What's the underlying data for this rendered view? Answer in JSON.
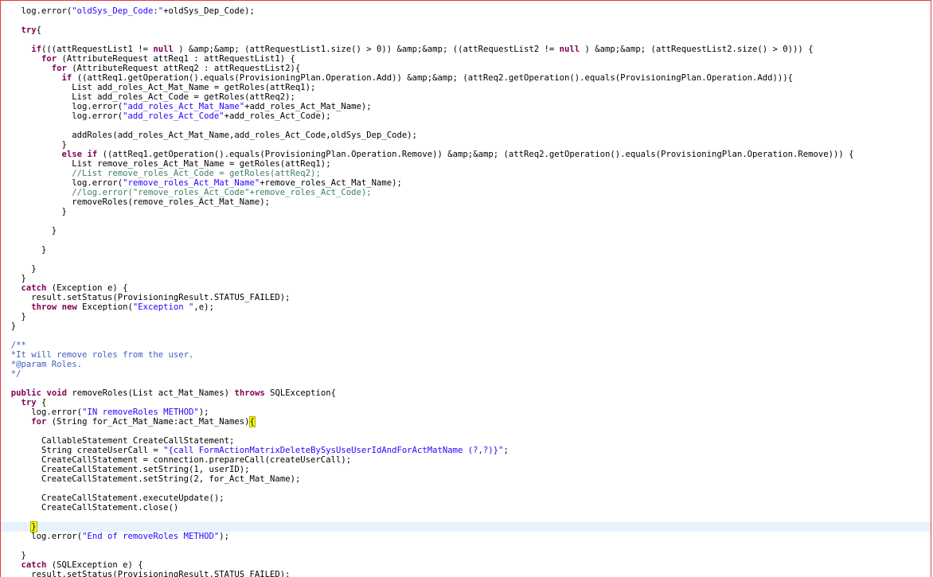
{
  "code_lines": {
    "l01": {
      "indent": "    ",
      "pre": "log.error(",
      "s": "\"oldSys_Dep_Code:\"",
      "post": "+oldSys_Dep_Code);"
    },
    "l03": {
      "indent": "    ",
      "kw": "try",
      "post": "{"
    },
    "l05_indent": "      ",
    "l05_kw": "if",
    "l05_a": "(((attRequestList1 != ",
    "l05_null1": "null",
    "l05_b": " ) &amp;&amp; (attRequestList1.size() > ",
    "l05_n1": "0",
    "l05_c": ")) &amp;&amp; ((attRequestList2 != ",
    "l05_null2": "null",
    "l05_d": " ) &amp;&amp; (attRequestList2.size() > ",
    "l05_n2": "0",
    "l05_e": "))) {",
    "l06_indent": "        ",
    "l06_kw": "for",
    "l06_rest": " (AttributeRequest attReq1 : attRequestList1) {",
    "l07_indent": "          ",
    "l07_kw": "for",
    "l07_rest": " (AttributeRequest attReq2 : attRequestList2){",
    "l08_indent": "            ",
    "l08_kw": "if",
    "l08_rest": " ((attReq1.getOperation().equals(ProvisioningPlan.Operation.Add)) &amp;&amp; (attReq2.getOperation().equals(ProvisioningPlan.Operation.Add))){",
    "l09": "              List add_roles_Act_Mat_Name = getRoles(attReq1);",
    "l10": "              List add_roles_Act_Code = getRoles(attReq2);",
    "l11_pre": "              log.error(",
    "l11_s": "\"add_roles_Act_Mat_Name\"",
    "l11_post": "+add_roles_Act_Mat_Name);",
    "l12_pre": "              log.error(",
    "l12_s": "\"add_roles_Act_Code\"",
    "l12_post": "+add_roles_Act_Code);",
    "l14": "              addRoles(add_roles_Act_Mat_Name,add_roles_Act_Code,oldSys_Dep_Code);",
    "l15": "            }",
    "l16_indent": "            ",
    "l16_kw1": "else",
    "l16_sp": " ",
    "l16_kw2": "if",
    "l16_rest": " ((attReq1.getOperation().equals(ProvisioningPlan.Operation.Remove)) &amp;&amp; (attReq2.getOperation().equals(ProvisioningPlan.Operation.Remove))) {",
    "l17": "              List remove_roles_Act_Mat_Name = getRoles(attReq1);",
    "l18_indent": "              ",
    "l18_c": "//List remove_roles_Act_Code = getRoles(attReq2);",
    "l19_pre": "              log.error(",
    "l19_s": "\"remove_roles_Act_Mat_Name\"",
    "l19_post": "+remove_roles_Act_Mat_Name);",
    "l20_indent": "              ",
    "l20_c": "//log.error(\"remove_roles_Act_Code\"+remove_roles_Act_Code);",
    "l21": "              removeRoles(remove_roles_Act_Mat_Name);",
    "l22": "            }",
    "l24": "          }",
    "l26": "        }",
    "l28": "      }",
    "l29": "    }",
    "l30_indent": "    ",
    "l30_kw": "catch",
    "l30_rest": " (Exception e) {",
    "l31": "      result.setStatus(ProvisioningResult.STATUS_FAILED);",
    "l32_indent": "      ",
    "l32_kw1": "throw",
    "l32_sp": " ",
    "l32_kw2": "new",
    "l32_pre": " Exception(",
    "l32_s": "\"Exception \"",
    "l32_post": ",e);",
    "l33": "    }",
    "l34": "  }",
    "l36": "  /**",
    "l37": "  *It will remove roles from the user.",
    "l38": "  *@param Roles.",
    "l39": "  */",
    "l41_indent": "  ",
    "l41_kw1": "public",
    "l41_sp": " ",
    "l41_kw2": "void",
    "l41_mid": " removeRoles(List act_Mat_Names) ",
    "l41_kw3": "throws",
    "l41_rest": " SQLException{",
    "l42_indent": "    ",
    "l42_kw": "try",
    "l42_rest": " {",
    "l43_pre": "      log.error(",
    "l43_s": "\"IN removeRoles METHOD\"",
    "l43_post": ");",
    "l44_indent": "      ",
    "l44_kw": "for",
    "l44_rest": " (String for_Act_Mat_Name:act_Mat_Names)",
    "l44_brace": "{",
    "l46": "        CallableStatement CreateCallStatement;",
    "l47_pre": "        String createUserCall = ",
    "l47_s": "\"{call FormActionMatrixDeleteBySysUseUserIdAndForActMatName (?,?)}\"",
    "l47_post": ";",
    "l48": "        CreateCallStatement = connection.prepareCall(createUserCall);",
    "l49_pre": "        CreateCallStatement.setString(",
    "l49_n": "1",
    "l49_post": ", userID);",
    "l50_pre": "        CreateCallStatement.setString(",
    "l50_n": "2",
    "l50_post": ", for_Act_Mat_Name);",
    "l52": "        CreateCallStatement.executeUpdate();",
    "l53": "        CreateCallStatement.close()",
    "l55_indent": "      ",
    "l55_brace": "}",
    "l56_pre": "      log.error(",
    "l56_s": "\"End of removeRoles METHOD\"",
    "l56_post": ");",
    "l58": "    }",
    "l59_indent": "    ",
    "l59_kw": "catch",
    "l59_rest": " (SQLException e) {",
    "l60": "      result.setStatus(ProvisioningResult.STATUS_FAILED);"
  }
}
